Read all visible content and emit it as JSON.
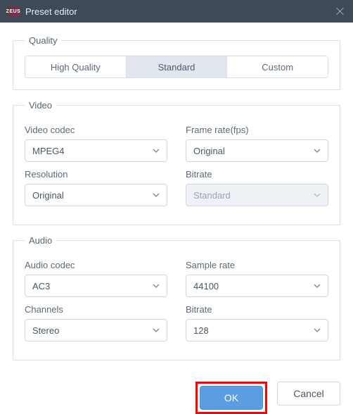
{
  "window": {
    "title": "Preset editor",
    "logo_text": "ZEUS"
  },
  "quality": {
    "legend": "Quality",
    "tabs": [
      "High Quality",
      "Standard",
      "Custom"
    ],
    "active_index": 1
  },
  "video": {
    "legend": "Video",
    "codec": {
      "label": "Video codec",
      "value": "MPEG4"
    },
    "framerate": {
      "label": "Frame rate(fps)",
      "value": "Original"
    },
    "resolution": {
      "label": "Resolution",
      "value": "Original"
    },
    "bitrate": {
      "label": "Bitrate",
      "value": "Standard",
      "disabled": true
    }
  },
  "audio": {
    "legend": "Audio",
    "codec": {
      "label": "Audio codec",
      "value": "AC3"
    },
    "samplerate": {
      "label": "Sample rate",
      "value": "44100"
    },
    "channels": {
      "label": "Channels",
      "value": "Stereo"
    },
    "bitrate": {
      "label": "Bitrate",
      "value": "128"
    }
  },
  "footer": {
    "ok": "OK",
    "cancel": "Cancel"
  }
}
